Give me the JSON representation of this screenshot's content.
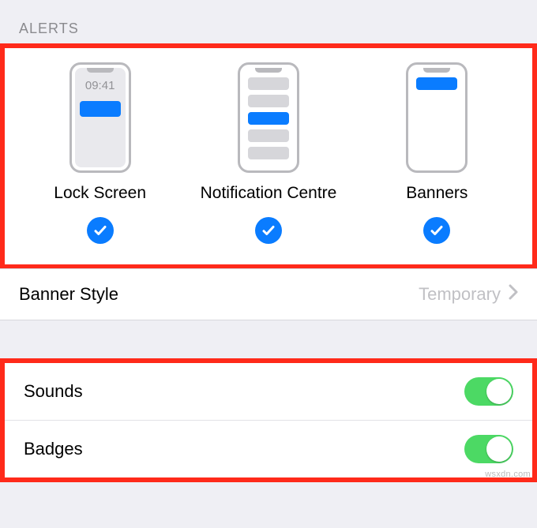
{
  "section": {
    "alerts_header": "ALERTS"
  },
  "alerts": {
    "lock_screen": {
      "label": "Lock Screen",
      "time": "09:41",
      "checked": true
    },
    "notification_centre": {
      "label": "Notification Centre",
      "checked": true
    },
    "banners": {
      "label": "Banners",
      "checked": true
    }
  },
  "banner_style": {
    "label": "Banner Style",
    "value": "Temporary"
  },
  "sounds": {
    "label": "Sounds",
    "on": true
  },
  "badges": {
    "label": "Badges",
    "on": true
  },
  "watermark": "wsxdn.com"
}
